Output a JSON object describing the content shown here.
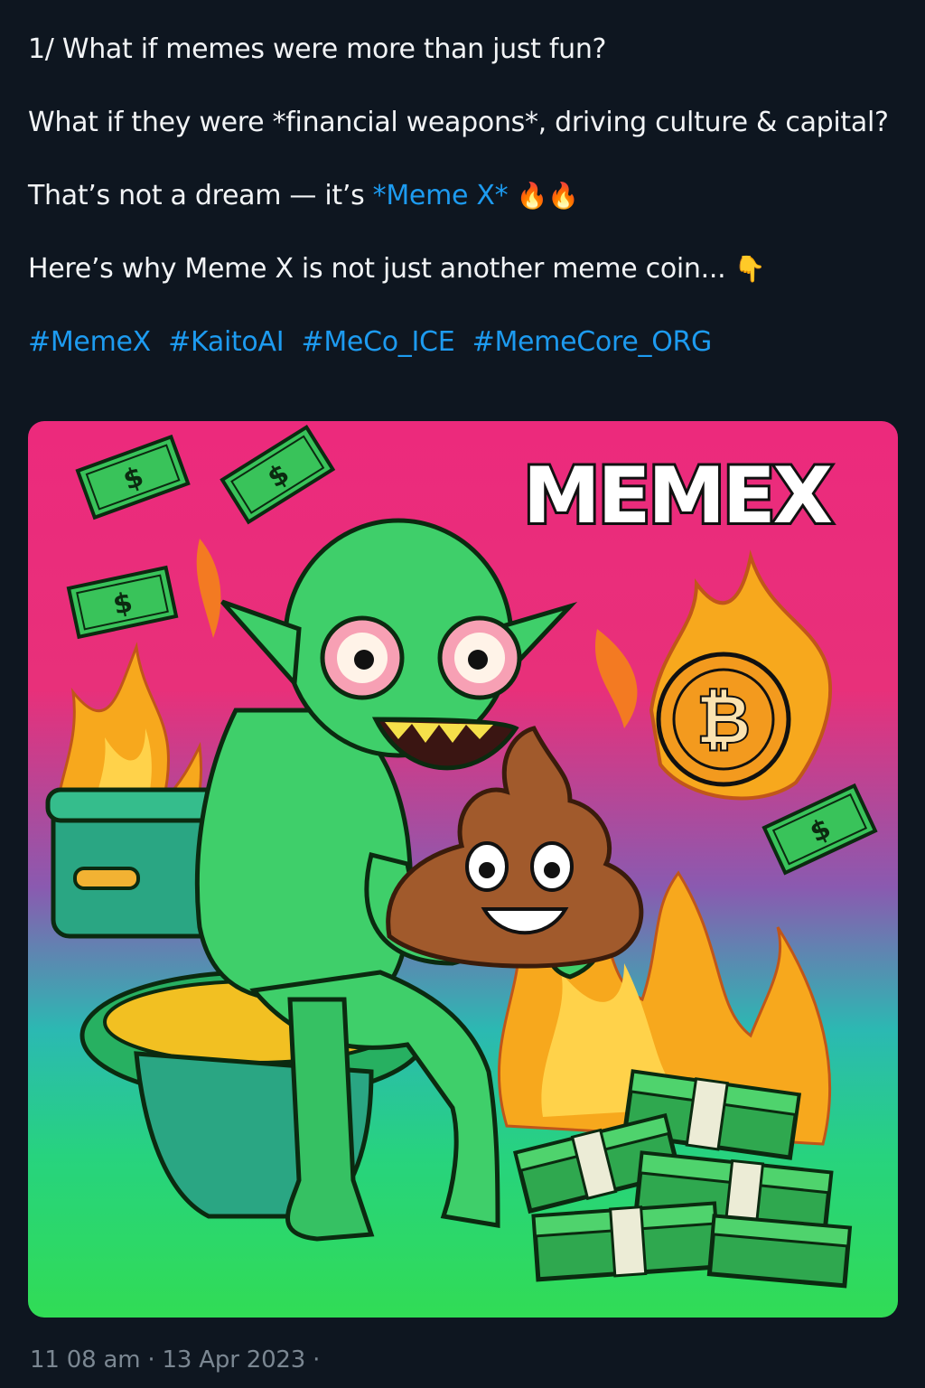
{
  "tweet": {
    "line1": "1/ What if memes were more than just fun?",
    "line2": "What if they were *financial weapons*, driving culture & capital?",
    "line3_prefix": "That’s not a dream — it’s ",
    "line3_highlight": "*Meme X*",
    "line3_emojis": "🔥🔥",
    "line4": "Here’s why Meme X is not just another meme coin...",
    "line4_emoji": "👇",
    "hashtags": [
      "#MemeX",
      "#KaitoAI",
      "#MeCo_ICE",
      "#MemeCore_ORG"
    ]
  },
  "media": {
    "title_text": "MEMEX",
    "coin_symbol": "₿",
    "bill_symbol": "$",
    "colors": {
      "top": "#ec2a7c",
      "middle": "#2bb9b2",
      "bottom": "#31dc55",
      "creature": "#3fcf6a",
      "money": "#39c35a",
      "coin": "#f39a1e"
    }
  },
  "timestamp": "11 08 am · 13 Apr 2023 ·"
}
